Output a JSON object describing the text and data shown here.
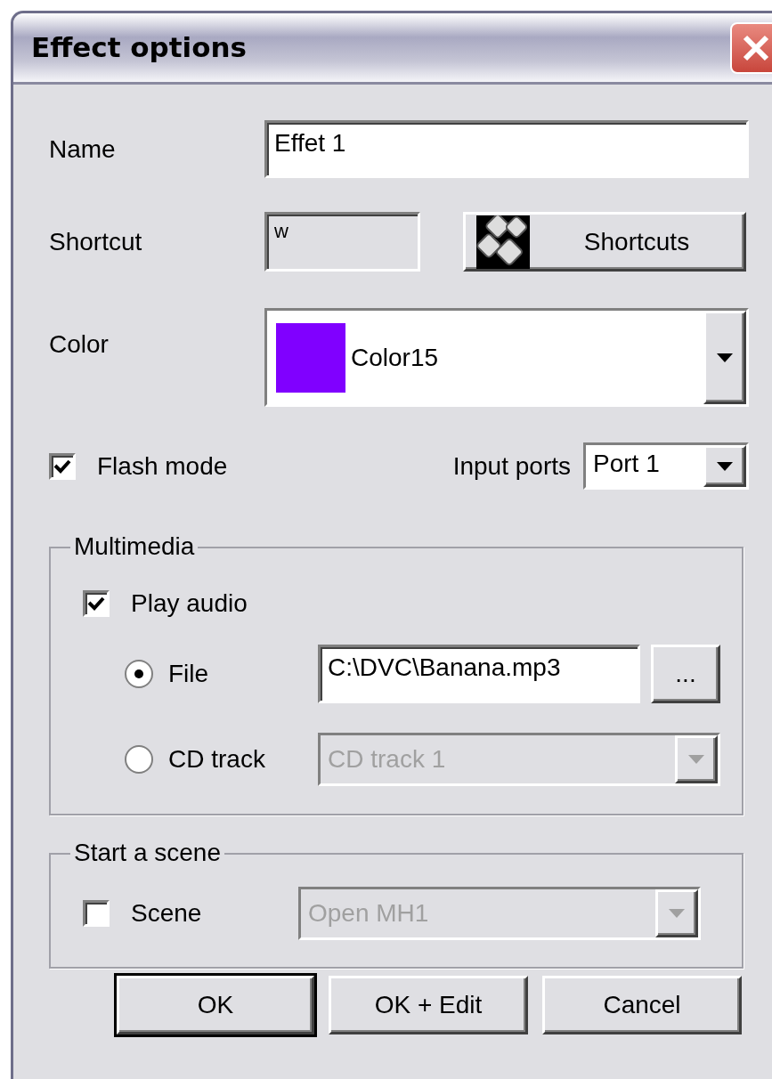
{
  "window": {
    "title": "Effect options"
  },
  "name": {
    "label": "Name",
    "value": "Effet 1"
  },
  "shortcut": {
    "label": "Shortcut",
    "value": "w",
    "button": "Shortcuts"
  },
  "color": {
    "label": "Color",
    "value": "Color15",
    "color": "#8000ff"
  },
  "flash_mode": {
    "label": "Flash mode",
    "checked": true
  },
  "input_ports": {
    "label": "Input ports",
    "value": "Port 1"
  },
  "multimedia": {
    "title": "Multimedia",
    "play_audio": {
      "label": "Play audio",
      "checked": true
    },
    "sources": [
      {
        "kind": "file",
        "label": "File",
        "selected": true,
        "value": "C:\\DVC\\Banana.mp3",
        "button": "...",
        "disabled": false
      },
      {
        "kind": "dropdown",
        "label": "CD track",
        "selected": false,
        "value": "CD track 1",
        "disabled": true
      }
    ]
  },
  "start_scene": {
    "title": "Start a scene",
    "scene": {
      "label": "Scene",
      "checked": false,
      "value": "Open MH1",
      "disabled": true
    }
  },
  "buttons": [
    {
      "label": "OK",
      "default": true
    },
    {
      "label": "OK + Edit",
      "default": false
    },
    {
      "label": "Cancel",
      "default": false
    }
  ]
}
